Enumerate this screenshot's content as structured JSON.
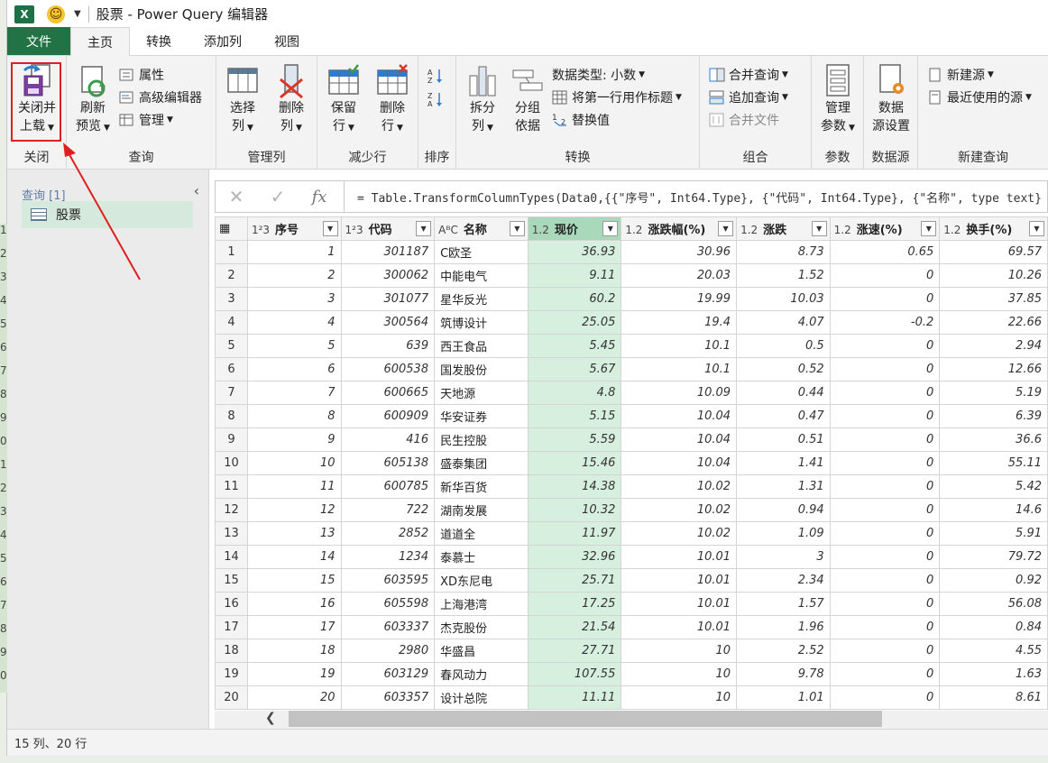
{
  "window": {
    "app_icon": "X",
    "title": "股票 - Power Query 编辑器"
  },
  "excel_row_numbers": [
    "1",
    "2",
    "3",
    "4",
    "5",
    "6",
    "7",
    "8",
    "9",
    "0",
    "1",
    "2",
    "3",
    "4",
    "5",
    "6",
    "7",
    "8",
    "9",
    "0"
  ],
  "tabs": [
    {
      "label": "文件"
    },
    {
      "label": "主页"
    },
    {
      "label": "转换"
    },
    {
      "label": "添加列"
    },
    {
      "label": "视图"
    }
  ],
  "ribbon": {
    "close_load": {
      "line1": "关闭并",
      "line2": "上载",
      "group": "关闭"
    },
    "query": {
      "refresh_line1": "刷新",
      "refresh_line2": "预览",
      "properties": "属性",
      "advanced_editor": "高级编辑器",
      "manage": "管理",
      "group": "查询"
    },
    "manage_columns": {
      "choose_line1": "选择",
      "choose_line2": "列",
      "remove_line1": "删除",
      "remove_line2": "列",
      "group": "管理列"
    },
    "reduce_rows": {
      "keep_line1": "保留",
      "keep_line2": "行",
      "remove_line1": "删除",
      "remove_line2": "行",
      "group": "减少行"
    },
    "sort": {
      "group": "排序"
    },
    "transform": {
      "split_line1": "拆分",
      "split_line2": "列",
      "group_line1": "分组",
      "group_line2": "依据",
      "data_type": "数据类型: 小数",
      "first_row_headers": "将第一行用作标题",
      "replace_values": "替换值",
      "group": "转换"
    },
    "combine": {
      "merge": "合并查询",
      "append": "追加查询",
      "combine_files": "合并文件",
      "group": "组合"
    },
    "params": {
      "line1": "管理",
      "line2": "参数",
      "group": "参数"
    },
    "datasource": {
      "line1": "数据",
      "line2": "源设置",
      "group": "数据源"
    },
    "new_query": {
      "new_source": "新建源",
      "recent_sources": "最近使用的源",
      "group": "新建查询"
    }
  },
  "query_pane": {
    "header": "查询 [1]",
    "items": [
      {
        "label": "股票"
      }
    ]
  },
  "formula_bar": {
    "formula": "= Table.TransformColumnTypes(Data0,{{\"序号\", Int64.Type}, {\"代码\", Int64.Type}, {\"名称\", type text}"
  },
  "table": {
    "columns": [
      {
        "type": "1²3",
        "name": "序号"
      },
      {
        "type": "1²3",
        "name": "代码"
      },
      {
        "type": "AᴮC",
        "name": "名称"
      },
      {
        "type": "1.2",
        "name": "现价"
      },
      {
        "type": "1.2",
        "name": "涨跌幅(%)"
      },
      {
        "type": "1.2",
        "name": "涨跌"
      },
      {
        "type": "1.2",
        "name": "涨速(%)"
      },
      {
        "type": "1.2",
        "name": "换手(%)"
      }
    ],
    "rows": [
      [
        "1",
        "301187",
        "C欧圣",
        "36.93",
        "30.96",
        "8.73",
        "0.65",
        "69.57"
      ],
      [
        "2",
        "300062",
        "中能电气",
        "9.11",
        "20.03",
        "1.52",
        "0",
        "10.26"
      ],
      [
        "3",
        "301077",
        "星华反光",
        "60.2",
        "19.99",
        "10.03",
        "0",
        "37.85"
      ],
      [
        "4",
        "300564",
        "筑博设计",
        "25.05",
        "19.4",
        "4.07",
        "-0.2",
        "22.66"
      ],
      [
        "5",
        "639",
        "西王食品",
        "5.45",
        "10.1",
        "0.5",
        "0",
        "2.94"
      ],
      [
        "6",
        "600538",
        "国发股份",
        "5.67",
        "10.1",
        "0.52",
        "0",
        "12.66"
      ],
      [
        "7",
        "600665",
        "天地源",
        "4.8",
        "10.09",
        "0.44",
        "0",
        "5.19"
      ],
      [
        "8",
        "600909",
        "华安证券",
        "5.15",
        "10.04",
        "0.47",
        "0",
        "6.39"
      ],
      [
        "9",
        "416",
        "民生控股",
        "5.59",
        "10.04",
        "0.51",
        "0",
        "36.6"
      ],
      [
        "10",
        "605138",
        "盛泰集团",
        "15.46",
        "10.04",
        "1.41",
        "0",
        "55.11"
      ],
      [
        "11",
        "600785",
        "新华百货",
        "14.38",
        "10.02",
        "1.31",
        "0",
        "5.42"
      ],
      [
        "12",
        "722",
        "湖南发展",
        "10.32",
        "10.02",
        "0.94",
        "0",
        "14.6"
      ],
      [
        "13",
        "2852",
        "道道全",
        "11.97",
        "10.02",
        "1.09",
        "0",
        "5.91"
      ],
      [
        "14",
        "1234",
        "泰慕士",
        "32.96",
        "10.01",
        "3",
        "0",
        "79.72"
      ],
      [
        "15",
        "603595",
        "XD东尼电",
        "25.71",
        "10.01",
        "2.34",
        "0",
        "0.92"
      ],
      [
        "16",
        "605598",
        "上海港湾",
        "17.25",
        "10.01",
        "1.57",
        "0",
        "56.08"
      ],
      [
        "17",
        "603337",
        "杰克股份",
        "21.54",
        "10.01",
        "1.96",
        "0",
        "0.84"
      ],
      [
        "18",
        "2980",
        "华盛昌",
        "27.71",
        "10",
        "2.52",
        "0",
        "4.55"
      ],
      [
        "19",
        "603129",
        "春风动力",
        "107.55",
        "10",
        "9.78",
        "0",
        "1.63"
      ],
      [
        "20",
        "603357",
        "设计总院",
        "11.11",
        "10",
        "1.01",
        "0",
        "8.61"
      ]
    ]
  },
  "status": {
    "text": "15 列、20 行"
  }
}
